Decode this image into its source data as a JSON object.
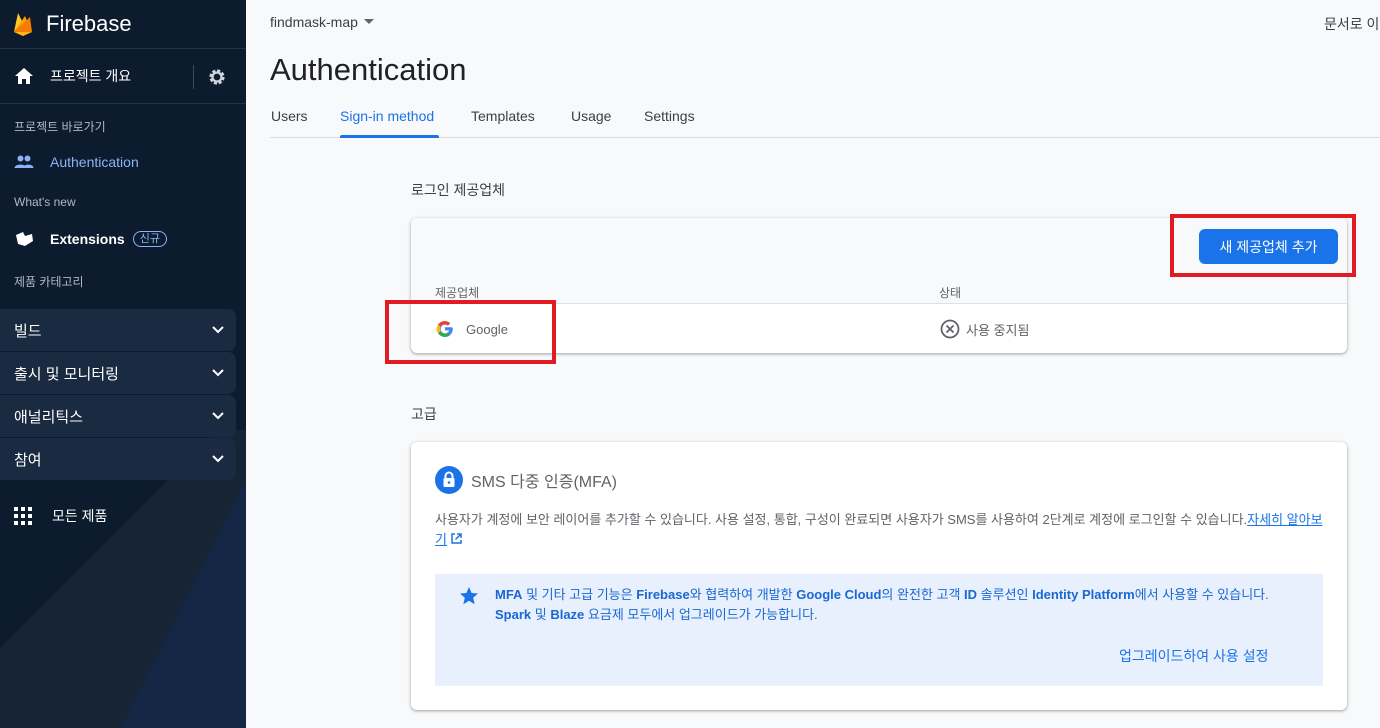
{
  "sidebar": {
    "brand": "Firebase",
    "overview": "프로젝트 개요",
    "shortcuts_section": "프로젝트 바로가기",
    "authentication": "Authentication",
    "whats_new": "What's new",
    "extensions": "Extensions",
    "extensions_badge": "신규",
    "product_categories": "제품 카테고리",
    "categories": [
      {
        "label": "빌드"
      },
      {
        "label": "출시 및 모니터링"
      },
      {
        "label": "애널리틱스"
      },
      {
        "label": "참여"
      }
    ],
    "all_products": "모든 제품"
  },
  "header": {
    "project": "findmask-map",
    "docs_link": "문서로 이"
  },
  "page": {
    "title": "Authentication",
    "tabs": [
      {
        "label": "Users"
      },
      {
        "label": "Sign-in method"
      },
      {
        "label": "Templates"
      },
      {
        "label": "Usage"
      },
      {
        "label": "Settings"
      }
    ]
  },
  "providers": {
    "section_title": "로그인 제공업체",
    "add_button": "새 제공업체 추가",
    "col_provider": "제공업체",
    "col_status": "상태",
    "rows": [
      {
        "provider": "Google",
        "status": "사용 중지됨"
      }
    ]
  },
  "advanced": {
    "section_title": "고급",
    "mfa_title": "SMS 다중 인증(MFA)",
    "mfa_desc": "사용자가 계정에 보안 레이어를 추가할 수 있습니다. 사용 설정, 통합, 구성이 완료되면 사용자가 SMS를 사용하여 2단계로 계정에 로그인할 수 있습니다.",
    "learn_more": "자세히 알아보기",
    "info": {
      "t1": "MFA",
      "t2": " 및 기타 고급 기능은 ",
      "t3": "Firebase",
      "t4": "와 협력하여 개발한 ",
      "t5": "Google Cloud",
      "t6": "의 완전한 고객 ",
      "t7": "ID",
      "t8": " 솔루션인 ",
      "t9": "Identity Platform",
      "t10": "에서 사용할 수 있습니다. ",
      "t11": "Spark",
      "t12": " 및 ",
      "t13": "Blaze",
      "t14": " 요금제 모두에서 업그레이드가 가능합니다."
    },
    "upgrade_link": "업그레이드하여 사용 설정"
  },
  "colors": {
    "accent": "#1a73e8",
    "sidebar_bg": "#0d1b2e",
    "highlight": "#e01b22"
  }
}
